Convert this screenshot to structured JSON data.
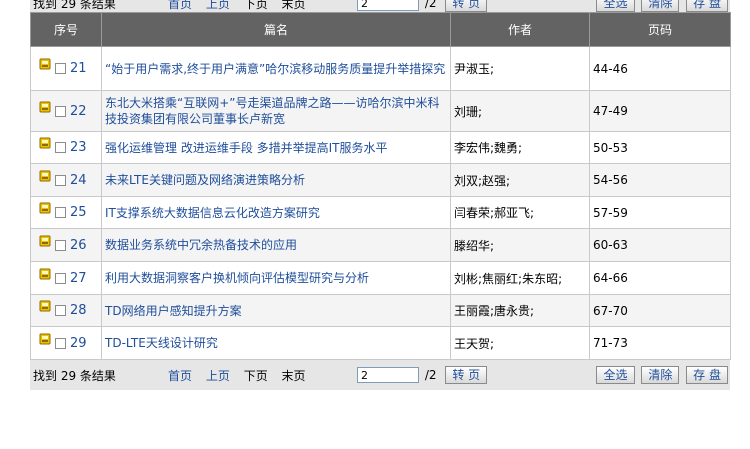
{
  "toolbar": {
    "found_text": "找到 29 条结果",
    "first": "首页",
    "prev": "上页",
    "next": "下页",
    "last": "末页",
    "page_value": "2",
    "page_total": "/2",
    "go": "转 页",
    "select_all": "全选",
    "clear": "清除",
    "save": "存 盘"
  },
  "table": {
    "headers": [
      "序号",
      "篇名",
      "作者",
      "页码"
    ],
    "rows": [
      {
        "num": "21",
        "title": "“始于用户需求,终于用户满意”哈尔滨移动服务质量提升举措探究",
        "author": "尹淑玉;",
        "pages": "44-46"
      },
      {
        "num": "22",
        "title": "东北大米搭乘“互联网+”号走渠道品牌之路——访哈尔滨中米科技投资集团有限公司董事长卢新宽",
        "author": "刘珊;",
        "pages": "47-49"
      },
      {
        "num": "23",
        "title": "强化运维管理 改进运维手段 多措并举提高IT服务水平",
        "author": "李宏伟;魏勇;",
        "pages": "50-53"
      },
      {
        "num": "24",
        "title": "未来LTE关键问题及网络演进策略分析",
        "author": "刘双;赵强;",
        "pages": "54-56"
      },
      {
        "num": "25",
        "title": "IT支撑系统大数据信息云化改造方案研究",
        "author": "闫春荣;郝亚飞;",
        "pages": "57-59"
      },
      {
        "num": "26",
        "title": "数据业务系统中冗余热备技术的应用",
        "author": "滕绍华;",
        "pages": "60-63"
      },
      {
        "num": "27",
        "title": "利用大数据洞察客户换机倾向评估模型研究与分析",
        "author": "刘彬;焦丽红;朱东昭;",
        "pages": "64-66"
      },
      {
        "num": "28",
        "title": "TD网络用户感知提升方案",
        "author": "王丽霞;唐永贵;",
        "pages": "67-70"
      },
      {
        "num": "29",
        "title": "TD-LTE天线设计研究",
        "author": "王天贺;",
        "pages": "71-73"
      }
    ]
  },
  "colors": {
    "header_bg": "#636363",
    "link": "#1f4e9a",
    "bar_bg": "#e6e6e6",
    "icon": "#f0c000"
  }
}
